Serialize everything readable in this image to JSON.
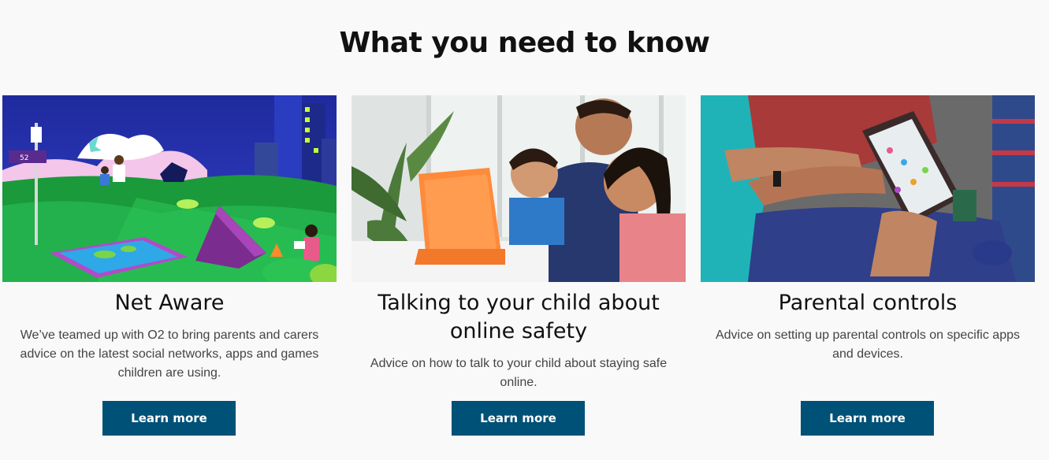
{
  "section": {
    "title": "What you need to know"
  },
  "colors": {
    "button_bg": "#005177",
    "button_text": "#ffffff",
    "page_bg": "#f9f9f9"
  },
  "cards": [
    {
      "heading": "Net Aware",
      "description": "We’ve teamed up with O2 to bring parents and carers advice on the latest social networks, apps and games children are using.",
      "button_label": "Learn more",
      "image_icon": "net-aware-illustration",
      "sign_text": "52"
    },
    {
      "heading": "Talking to your child about online safety",
      "description": "Advice on how to talk to your child about staying safe online.",
      "button_label": "Learn more",
      "image_icon": "family-tablet-photo"
    },
    {
      "heading": "Parental controls",
      "description": "Advice on setting up parental controls on specific apps and devices.",
      "button_label": "Learn more",
      "image_icon": "child-tablet-photo"
    }
  ]
}
